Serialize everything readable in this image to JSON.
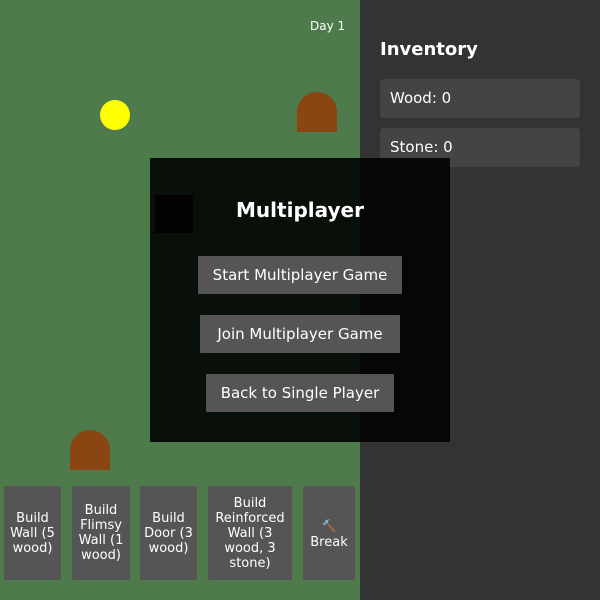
{
  "hud": {
    "day": "Day 1"
  },
  "inventory": {
    "title": "Inventory",
    "wood": "Wood: 0",
    "stone": "Stone: 0"
  },
  "toolbar": {
    "build_wall": "Build Wall (5 wood)",
    "build_flimsy_wall": "Build Flimsy Wall (1 wood)",
    "build_door": "Build Door (3 wood)",
    "build_reinforced_wall": "Build Reinforced Wall (3 wood, 3 stone)",
    "break_icon": "🔨",
    "break_label": "Break"
  },
  "modal": {
    "title": "Multiplayer",
    "start": "Start Multiplayer Game",
    "join": "Join Multiplayer Game",
    "back": "Back to Single Player"
  },
  "colors": {
    "field": "#4e7a4c",
    "panel": "#333333",
    "button": "#555555",
    "sun": "#ffff00",
    "tree": "#8b4513"
  }
}
